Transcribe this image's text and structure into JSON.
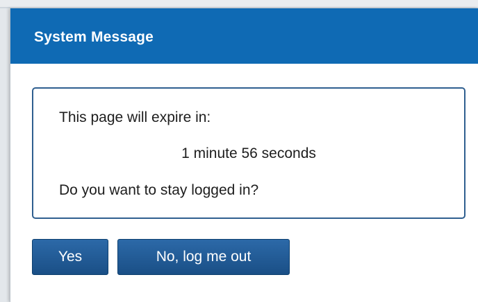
{
  "dialog": {
    "title": "System Message",
    "message": {
      "expire_text": "This page will expire in:",
      "countdown": "1 minute 56 seconds",
      "question": "Do you want to stay logged in?"
    },
    "buttons": {
      "yes_label": "Yes",
      "no_label": "No, log me out"
    }
  },
  "colors": {
    "header": "#0f6ab4",
    "button": "#1f5a94",
    "border": "#2f5f8f"
  }
}
